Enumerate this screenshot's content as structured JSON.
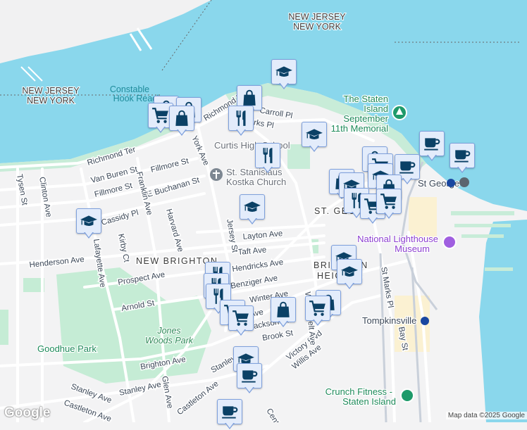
{
  "map": {
    "labels": {
      "nj_ny_top": [
        "NEW JERSEY",
        "NEW YORK"
      ],
      "nj_ny_left": [
        "NEW JERSEY",
        "NEW YORK"
      ],
      "constable_hook": [
        "Constable",
        "Hook Reach"
      ],
      "memorial": [
        "The Staten",
        "Island",
        "September",
        "11th Memorial"
      ],
      "curtis": "Curtis High School",
      "stanislaus": [
        "St. Stanislaus",
        "Kostka Church"
      ],
      "st_george_area": "ST. GEORGE",
      "st_george_station": "St George",
      "lighthouse": [
        "National Lighthouse",
        "Museum"
      ],
      "new_brighton": "NEW BRIGHTON",
      "brighton_heights": [
        "BRIGHTON",
        "HEIGHTS"
      ],
      "tompkinsville": "Tompkinsville",
      "crunch": [
        "Crunch Fitness -",
        "Staten Island"
      ],
      "jones_woods": [
        "Jones",
        "Woods Park"
      ],
      "goodhue": "Goodhue Park"
    },
    "streets": {
      "richmond_ter": "Richmond Ter",
      "richmond_ter2": "Richmond Ter",
      "van_buren": "Van Buren St",
      "fillmore1": "Fillmore St",
      "fillmore2": "Fillmore St",
      "e_buchanan": "E Buchanan St",
      "tysen": "Tysen St",
      "clinton": "Clinton Ave",
      "franklin": "Franklin Ave",
      "york": "York Ave",
      "harvard": "Harvard Ave",
      "cassidy": "Cassidy Pl",
      "kirby": "Kirby Ct",
      "lafayette": "Lafayette Ave",
      "henderson": "Henderson Ave",
      "layton": "Layton Ave",
      "taft": "Taft Ave",
      "hendricks": "Hendricks Ave",
      "prospect": "Prospect Ave",
      "arnold": "Arnold St",
      "jersey": "Jersey St",
      "carroll": "Carroll Pl",
      "marks": "St Marks Pl",
      "benziger": "Benziger Ave",
      "lafayette_st": "Ave",
      "st_marks_pl": "St Marks Pl",
      "bay": "Bay St",
      "brook": "Brook St",
      "victory": "Victory Blvd",
      "willis": "Willis Ave",
      "brighton": "Brighton Ave",
      "stanley1": "Stanley Ave",
      "stanley2": "Stanley Ave",
      "stanley3": "Stanley Ave",
      "glen": "Glen Ave",
      "castleton1": "Castleton Ave",
      "castleton2": "Castleton Ave",
      "westervelt": "Westervelt Ave",
      "winter": "Winter Ave",
      "jackson": "Jackson Ave",
      "central": "Central Ave"
    },
    "markers": [
      {
        "type": "school",
        "name": "school"
      },
      {
        "type": "shopping",
        "name": "shop"
      },
      {
        "type": "restaurant",
        "name": "restaurant"
      },
      {
        "type": "grocery",
        "name": "grocery"
      },
      {
        "type": "cafe",
        "name": "cafe"
      }
    ],
    "attribution": "Map data ©2025 Google",
    "logo": "Google"
  }
}
